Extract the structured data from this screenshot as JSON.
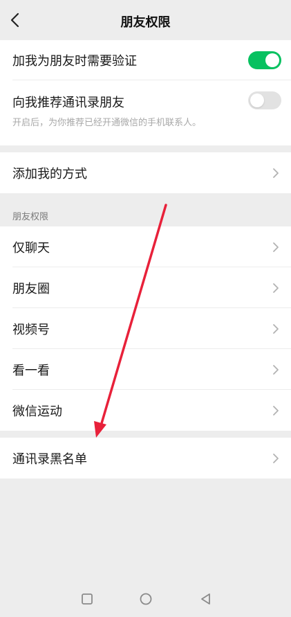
{
  "header": {
    "title": "朋友权限"
  },
  "verify": {
    "label": "加我为朋友时需要验证",
    "state": "on"
  },
  "recommend": {
    "label": "向我推荐通讯录朋友",
    "hint": "开启后，为你推荐已经开通微信的手机联系人。",
    "state": "off"
  },
  "add_methods": {
    "label": "添加我的方式"
  },
  "friend_permissions": {
    "section_title": "朋友权限",
    "items": [
      {
        "label": "仅聊天"
      },
      {
        "label": "朋友圈"
      },
      {
        "label": "视频号"
      },
      {
        "label": "看一看"
      },
      {
        "label": "微信运动"
      }
    ]
  },
  "blacklist": {
    "label": "通讯录黑名单"
  },
  "colors": {
    "accent_green": "#07c160",
    "annotation_arrow": "#e8213a"
  },
  "icons": [
    "back-icon",
    "chevron-right-icon",
    "square-nav-icon",
    "circle-nav-icon",
    "triangle-back-nav-icon"
  ]
}
